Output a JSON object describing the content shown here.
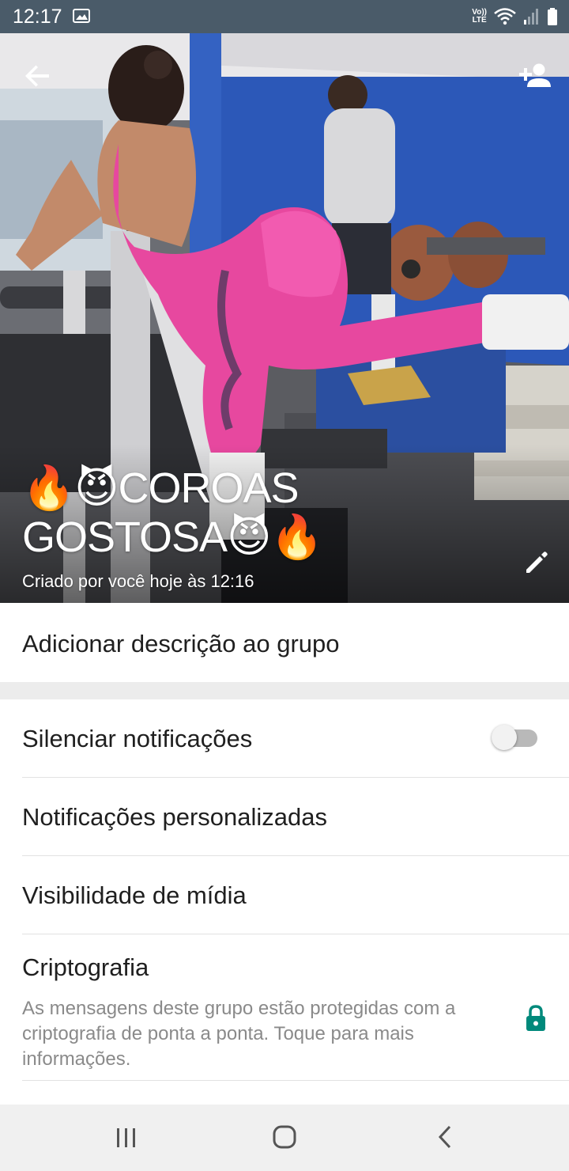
{
  "status_bar": {
    "time": "12:17",
    "volte_top": "Vo))",
    "volte_bottom": "LTE",
    "icons": [
      "gallery-icon",
      "volte-icon",
      "wifi-icon",
      "signal-icon",
      "battery-icon"
    ]
  },
  "header": {
    "group_name": "🔥😈COROAS GOSTOSA😈🔥",
    "created_text": "Criado por você hoje às 12:16",
    "icons": [
      "back-arrow-icon",
      "add-participant-icon",
      "edit-pencil-icon"
    ]
  },
  "description": {
    "label": "Adicionar descrição ao grupo"
  },
  "settings": {
    "mute_label": "Silenciar notificações",
    "mute_enabled": false,
    "custom_notifications_label": "Notificações personalizadas",
    "media_visibility_label": "Visibilidade de mídia",
    "encryption_label": "Criptografia",
    "encryption_desc": "As mensagens deste grupo estão protegidas com a criptografia de ponta a ponta. Toque para mais informações."
  },
  "colors": {
    "status_bar": "#4a5b69",
    "accent": "#00897b",
    "toggle_off": "#b9b9b9"
  },
  "nav_bar": {
    "icons": [
      "recent-apps-icon",
      "home-icon",
      "back-icon"
    ]
  }
}
